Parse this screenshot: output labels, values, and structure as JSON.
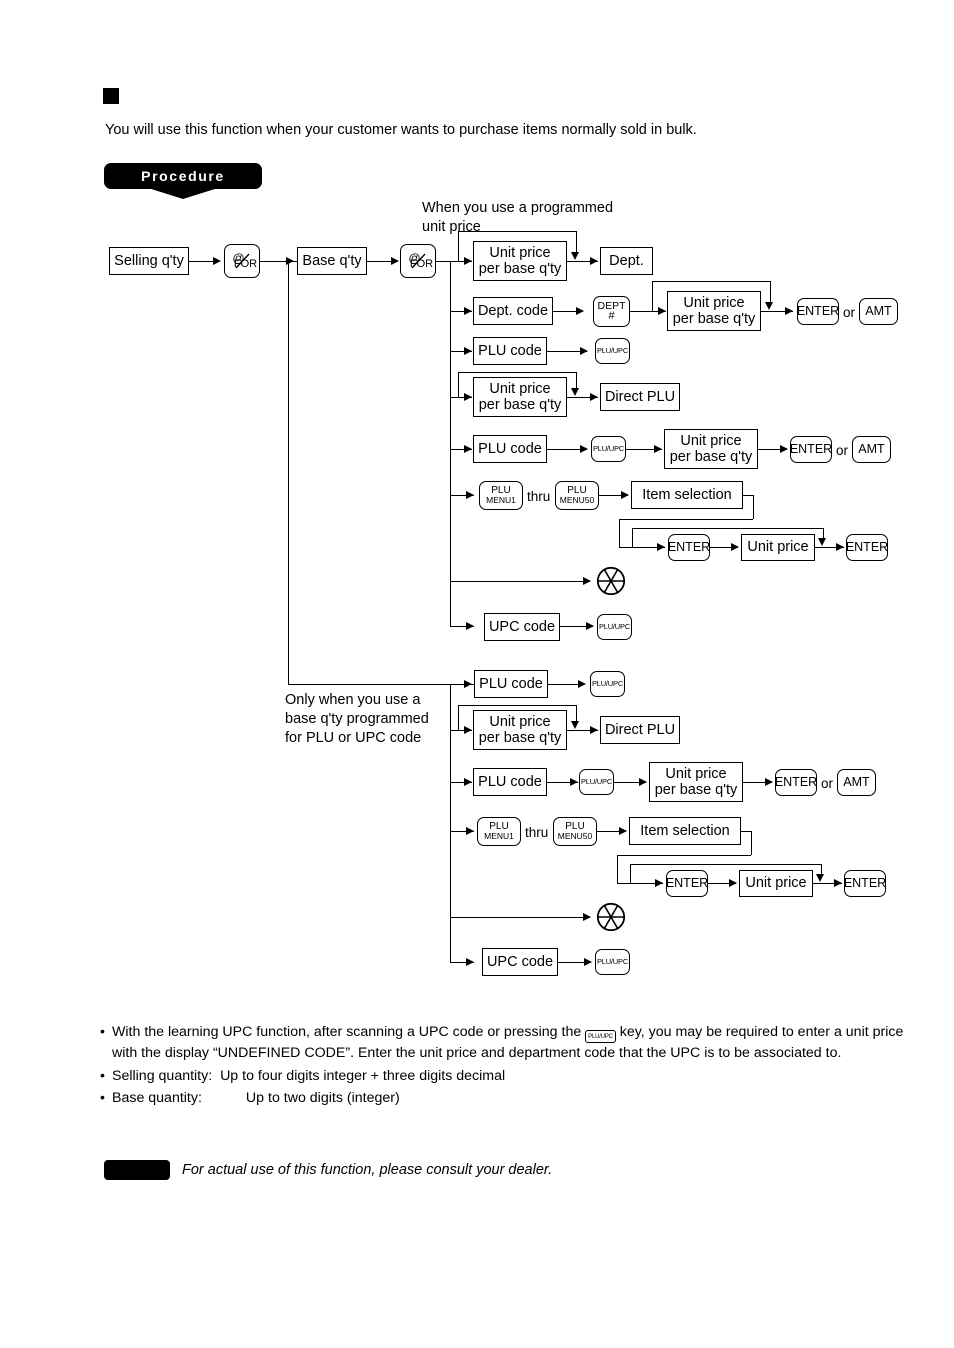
{
  "page": {
    "intro_text": "You will use this function when your customer wants to purchase items normally sold in bulk.",
    "procedure_label": "Procedure"
  },
  "flow": {
    "annotations": {
      "programmed_unit_price": "When you use a programmed\nunit price",
      "base_qty_note": "Only when you use a\nbase q'ty programmed\nfor PLU or UPC code",
      "thru": "thru",
      "or": "or"
    },
    "start": {
      "selling_qty": "Selling q'ty",
      "base_qty": "Base q'ty"
    },
    "keys": {
      "at_for_l1": "@",
      "at_for_l2": "FOR",
      "dept_l1": "DEPT",
      "dept_l2": "#",
      "plu_upc": "PLU/UPC",
      "plu_menu1_l1": "PLU",
      "plu_menu1_l2": "MENU1",
      "plu_menu50_l1": "PLU",
      "plu_menu50_l2": "MENU50",
      "enter": "ENTER",
      "amt": "AMT"
    },
    "boxes": {
      "unit_price_per_base_qty": "Unit price\nper base q'ty",
      "dept": "Dept.",
      "dept_code": "Dept. code",
      "plu_code": "PLU code",
      "direct_plu": "Direct PLU",
      "item_selection": "Item selection",
      "unit_price": "Unit price",
      "upc_code": "UPC code"
    },
    "scanner_symbol": "scanner-wheel"
  },
  "notes": {
    "bullet": "•",
    "items": [
      {
        "pre": "With the learning UPC function, after scanning a UPC code or pressing the ",
        "key": "PLU/UPC",
        "post": " key, you may be required to enter a unit price with the display “UNDEFINED CODE”.  Enter the unit price and department code that the UPC is to be associated to."
      },
      {
        "label": "Selling quantity:",
        "value": "Up to four digits integer + three digits decimal"
      },
      {
        "label": "Base quantity:",
        "value": "Up to two digits (integer)"
      }
    ],
    "dealer_note": "For actual use of this function, please consult your dealer."
  }
}
